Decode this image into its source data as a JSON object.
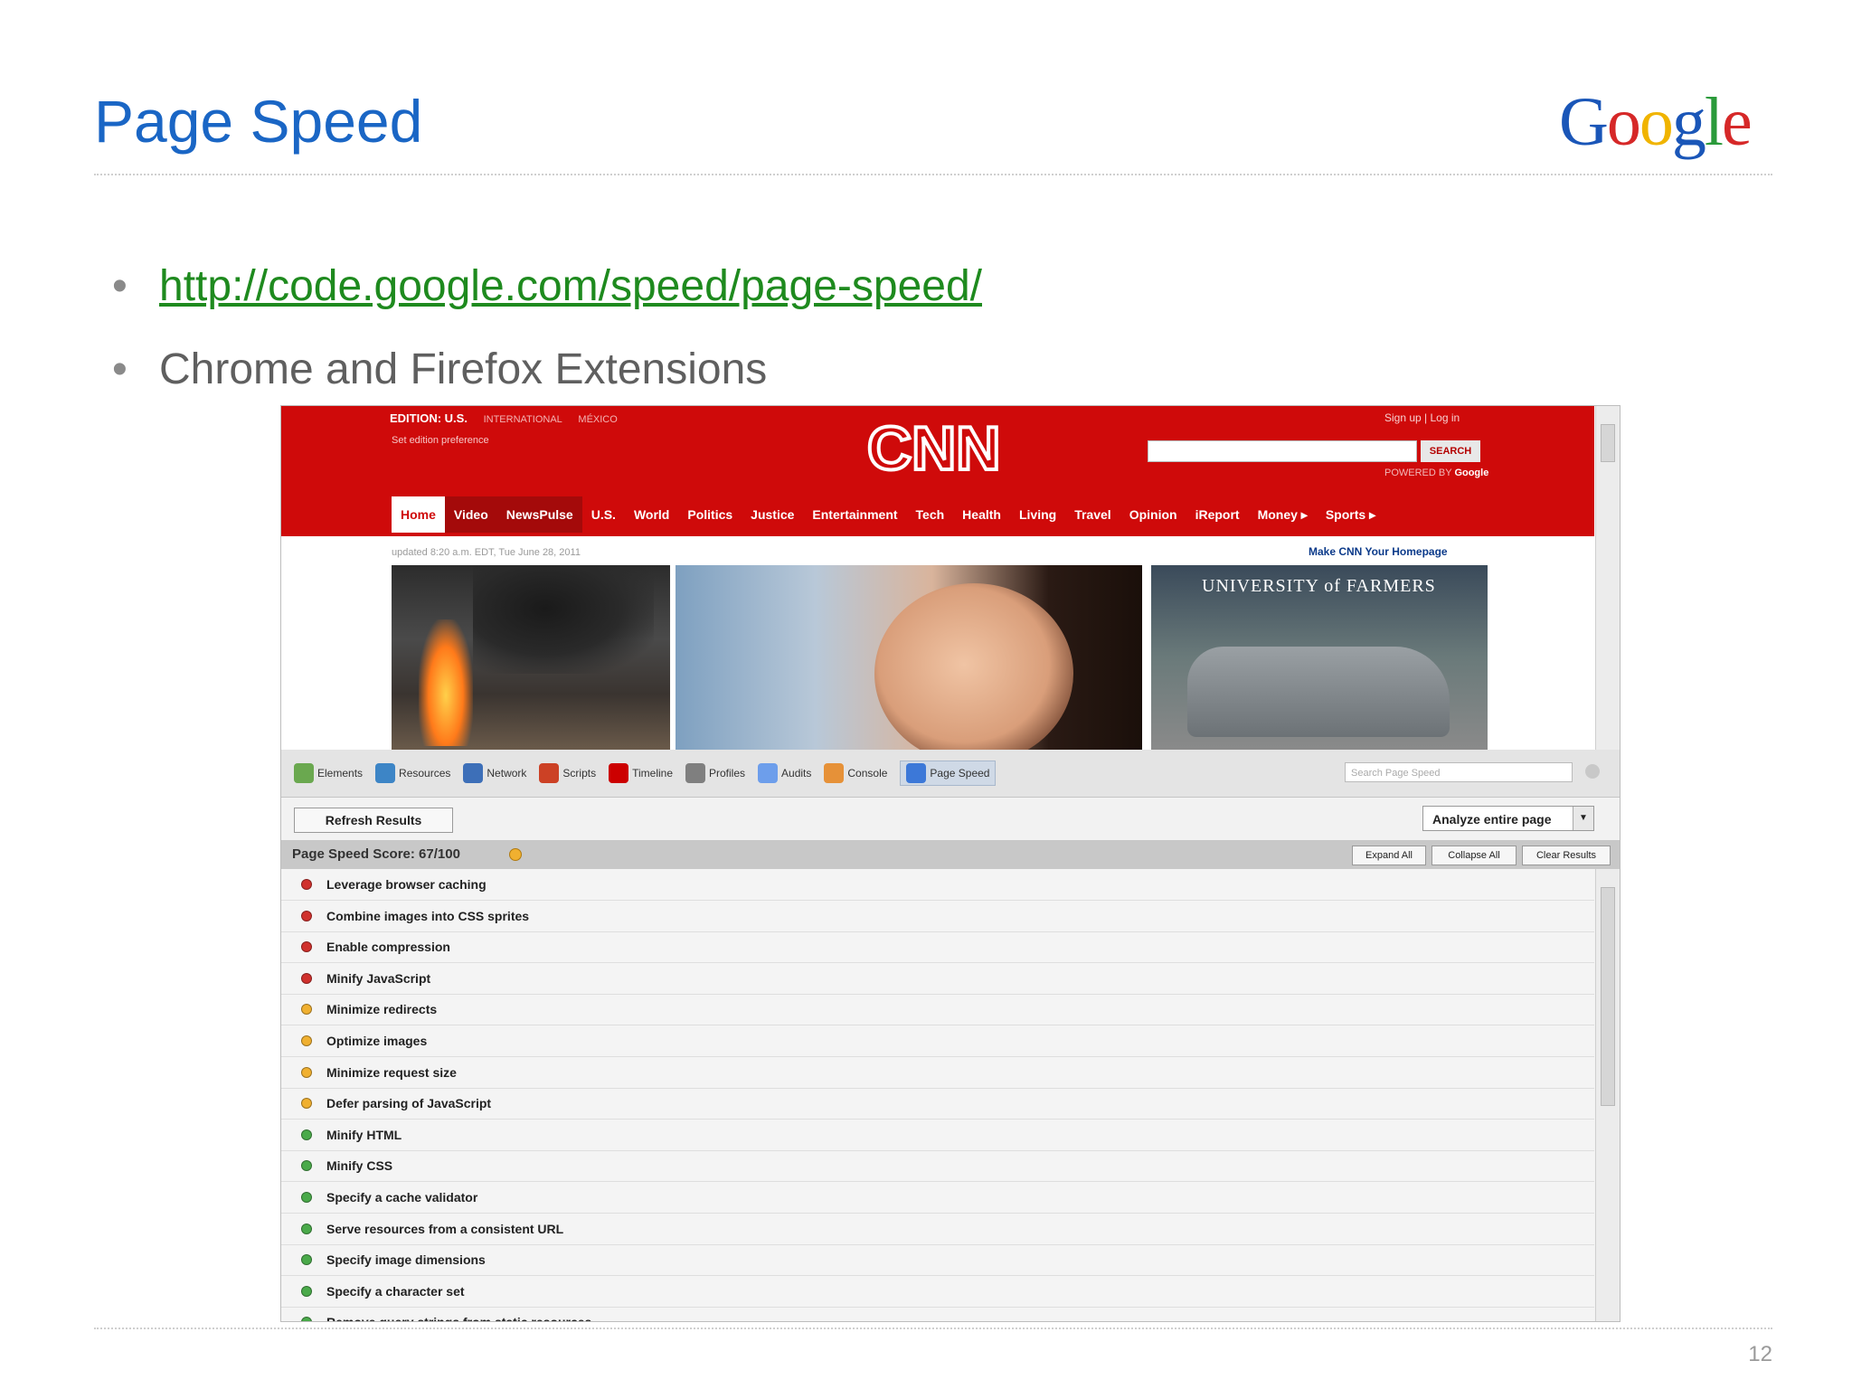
{
  "slide": {
    "title": "Page Speed",
    "logo_letters": [
      {
        "char": "G",
        "color": "#1a56b8"
      },
      {
        "char": "o",
        "color": "#d62828"
      },
      {
        "char": "o",
        "color": "#f0b400"
      },
      {
        "char": "g",
        "color": "#1a56b8"
      },
      {
        "char": "l",
        "color": "#2a9a3a"
      },
      {
        "char": "e",
        "color": "#d62828"
      }
    ],
    "bullets": [
      {
        "text": "http://code.google.com/speed/page-speed/",
        "is_link": true
      },
      {
        "text": "Chrome and Firefox Extensions",
        "is_link": false
      }
    ],
    "bullet_glyph": "•",
    "page_number": "12"
  },
  "cnn": {
    "edition_label": "EDITION: U.S.",
    "edition_intl": "INTERNATIONAL",
    "edition_mexico": "MÉXICO",
    "edition_pref": "Set edition preference",
    "sign_up": "Sign up",
    "log_in": "Log in",
    "logo_text": "CNN",
    "search_label": "SEARCH",
    "powered_by": "POWERED BY",
    "powered_google": "Google",
    "nav": [
      "Home",
      "Video",
      "NewsPulse",
      "U.S.",
      "World",
      "Politics",
      "Justice",
      "Entertainment",
      "Tech",
      "Health",
      "Living",
      "Travel",
      "Opinion",
      "iReport",
      "Money ▸",
      "Sports ▸"
    ],
    "updated": "updated 8:20 a.m. EDT, Tue June 28, 2011",
    "make_homepage": "Make CNN Your Homepage",
    "ad_title": "UNIVERSITY of FARMERS"
  },
  "devtools": {
    "tabs": [
      {
        "label": "Elements",
        "color": "#6aa84f"
      },
      {
        "label": "Resources",
        "color": "#3d85c6"
      },
      {
        "label": "Network",
        "color": "#3d6fb8"
      },
      {
        "label": "Scripts",
        "color": "#cc4125"
      },
      {
        "label": "Timeline",
        "color": "#cc0000"
      },
      {
        "label": "Profiles",
        "color": "#7f7f7f"
      },
      {
        "label": "Audits",
        "color": "#6d9eeb"
      },
      {
        "label": "Console",
        "color": "#e69138"
      },
      {
        "label": "Page Speed",
        "color": "#3c78d8",
        "active": true
      }
    ],
    "search_placeholder": "Search Page Speed",
    "refresh_label": "Refresh Results",
    "analyze_label": "Analyze entire page",
    "score_label": "Page Speed Score: 67/100",
    "expand_all": "Expand All",
    "collapse_all": "Collapse All",
    "clear_results": "Clear Results",
    "status_colors": {
      "red": "#d0312d",
      "orange": "#f0b030",
      "green": "#4aaa4a"
    },
    "rules": [
      {
        "label": "Leverage browser caching",
        "status": "red"
      },
      {
        "label": "Combine images into CSS sprites",
        "status": "red"
      },
      {
        "label": "Enable compression",
        "status": "red"
      },
      {
        "label": "Minify JavaScript",
        "status": "red"
      },
      {
        "label": "Minimize redirects",
        "status": "orange"
      },
      {
        "label": "Optimize images",
        "status": "orange"
      },
      {
        "label": "Minimize request size",
        "status": "orange"
      },
      {
        "label": "Defer parsing of JavaScript",
        "status": "orange"
      },
      {
        "label": "Minify HTML",
        "status": "green"
      },
      {
        "label": "Minify CSS",
        "status": "green"
      },
      {
        "label": "Specify a cache validator",
        "status": "green"
      },
      {
        "label": "Serve resources from a consistent URL",
        "status": "green"
      },
      {
        "label": "Specify image dimensions",
        "status": "green"
      },
      {
        "label": "Specify a character set",
        "status": "green"
      },
      {
        "label": "Remove query strings from static resources",
        "status": "green"
      }
    ]
  }
}
